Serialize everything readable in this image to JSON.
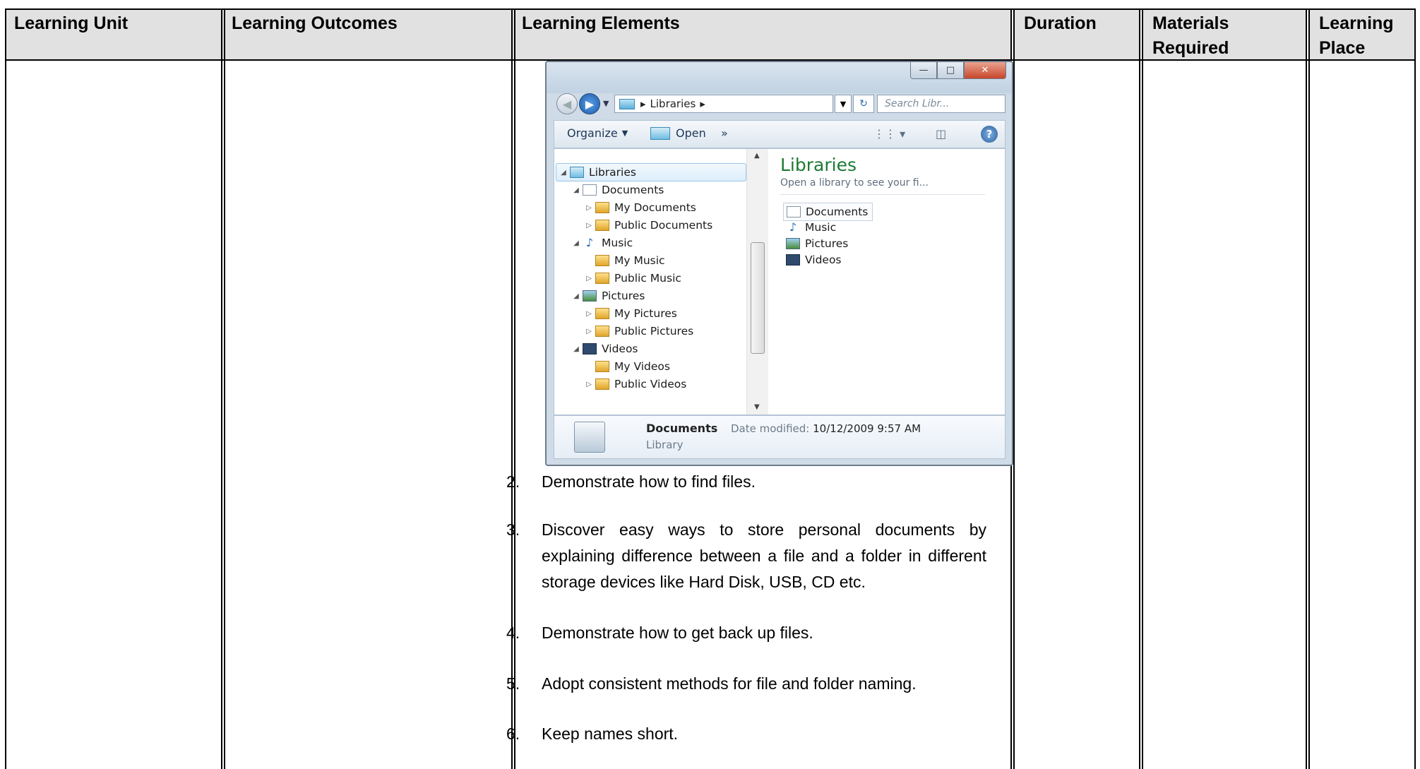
{
  "table": {
    "headers": [
      "Learning Unit",
      "Learning Outcomes",
      "Learning Elements",
      "Duration",
      "Materials Required",
      "Learning Place"
    ]
  },
  "explorer": {
    "address": "Libraries",
    "search_placeholder": "Search Libr...",
    "toolbar": {
      "organize": "Organize",
      "open": "Open",
      "more": "»"
    },
    "tree": [
      {
        "label": "Libraries",
        "icon": "library-icon",
        "level": 0
      },
      {
        "label": "Documents",
        "icon": "documents-library-icon",
        "level": 1
      },
      {
        "label": "My Documents",
        "icon": "folder-icon",
        "level": 2
      },
      {
        "label": "Public Documents",
        "icon": "folder-icon",
        "level": 2
      },
      {
        "label": "Music",
        "icon": "music-note-icon",
        "level": 1
      },
      {
        "label": "My Music",
        "icon": "folder-icon",
        "level": 2
      },
      {
        "label": "Public Music",
        "icon": "folder-icon",
        "level": 2
      },
      {
        "label": "Pictures",
        "icon": "pictures-library-icon",
        "level": 1
      },
      {
        "label": "My Pictures",
        "icon": "folder-icon",
        "level": 2
      },
      {
        "label": "Public Pictures",
        "icon": "folder-icon",
        "level": 2
      },
      {
        "label": "Videos",
        "icon": "videos-library-icon",
        "level": 1
      },
      {
        "label": "My Videos",
        "icon": "folder-icon",
        "level": 2
      },
      {
        "label": "Public Videos",
        "icon": "folder-icon",
        "level": 2
      }
    ],
    "pane": {
      "title": "Libraries",
      "subtitle": "Open a library to see your fi...",
      "items": [
        "Documents",
        "Music",
        "Pictures",
        "Videos"
      ]
    },
    "details": {
      "name": "Documents",
      "modified_label": "Date modified:",
      "modified_value": "10/12/2009 9:57 AM",
      "type": "Library"
    }
  },
  "elements": [
    {
      "num": "2.",
      "text": "Demonstrate how to find files."
    },
    {
      "num": "3.",
      "text": "Discover easy ways to store personal documents by explaining difference between a file and a folder in different storage devices like Hard Disk, USB, CD etc."
    },
    {
      "num": "4.",
      "text": "Demonstrate how to get back up files."
    },
    {
      "num": "5.",
      "text": "Adopt consistent methods for file and folder naming."
    },
    {
      "num": "6.",
      "text": "Keep names short."
    }
  ]
}
